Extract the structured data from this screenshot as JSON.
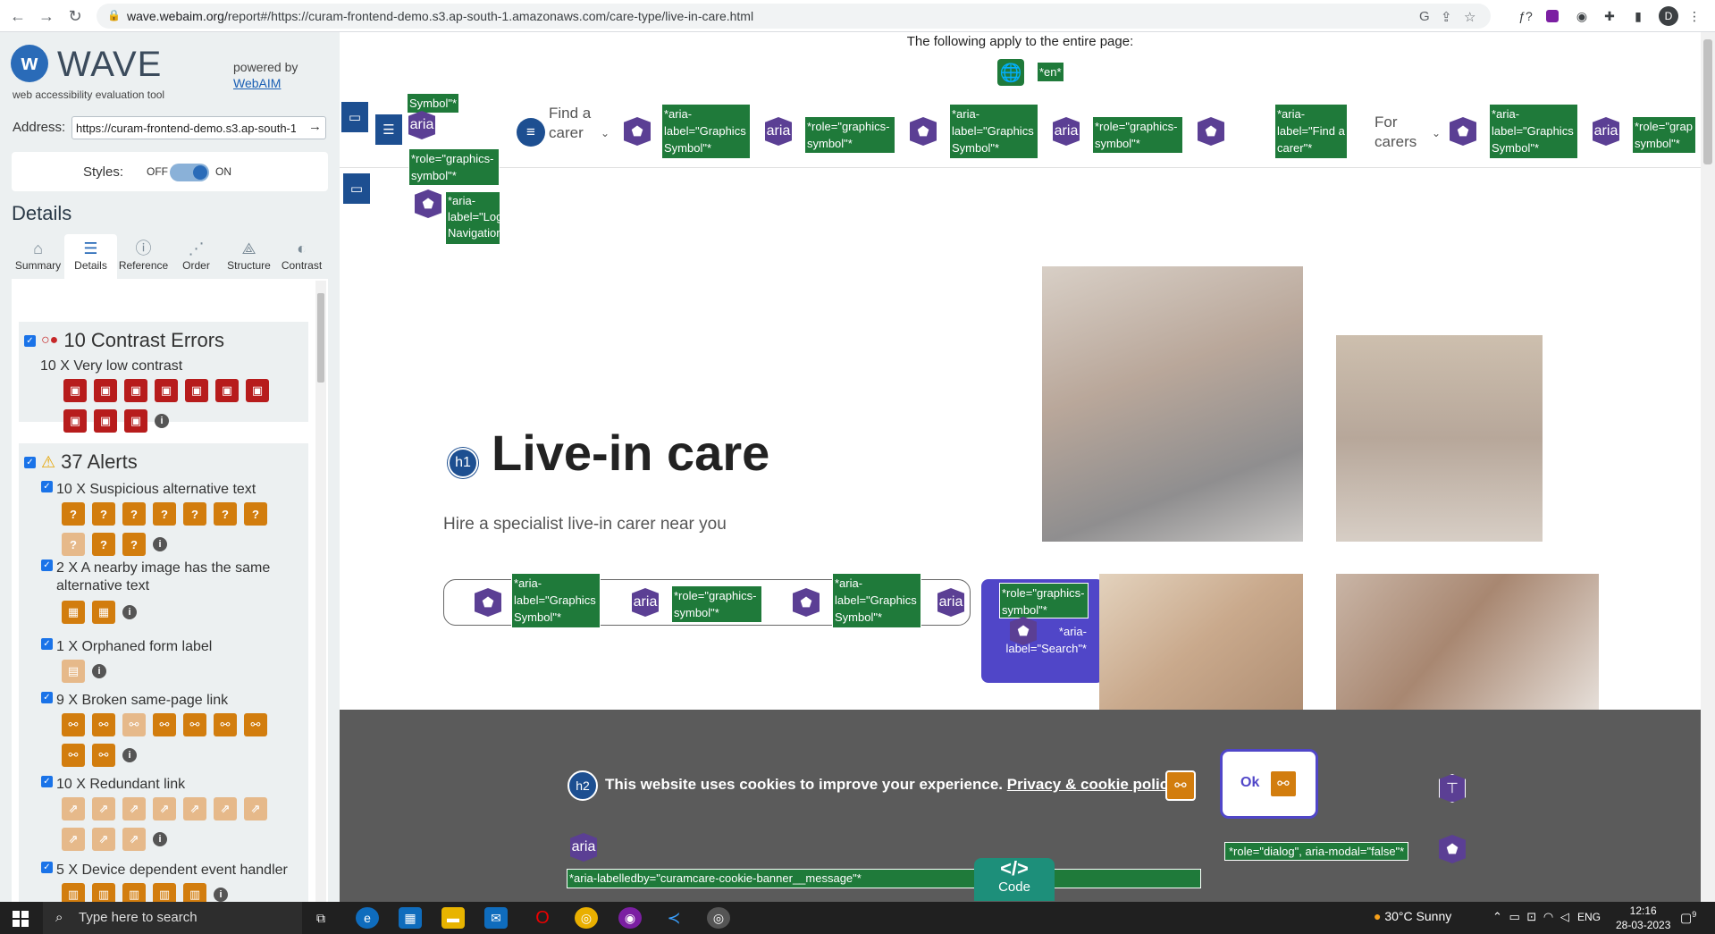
{
  "browser": {
    "url_prefix": "wave.webaim.org/",
    "url_rest": "report#/https://curam-frontend-demo.s3.ap-south-1.amazonaws.com/care-type/live-in-care.html",
    "avatar_letter": "D"
  },
  "wave": {
    "title": "WAVE",
    "subtitle": "web accessibility evaluation tool",
    "powered_by": "powered by",
    "powered_link": "WebAIM",
    "address_label": "Address:",
    "address_value": "https://curam-frontend-demo.s3.ap-south-1",
    "styles_label": "Styles:",
    "styles_off": "OFF",
    "styles_on": "ON",
    "details_heading": "Details",
    "tabs": [
      {
        "label": "Summary",
        "icon": "home-icon"
      },
      {
        "label": "Details",
        "icon": "list-icon"
      },
      {
        "label": "Reference",
        "icon": "info-icon"
      },
      {
        "label": "Order",
        "icon": "order-icon"
      },
      {
        "label": "Structure",
        "icon": "structure-icon"
      },
      {
        "label": "Contrast",
        "icon": "contrast-icon"
      }
    ],
    "contrast": {
      "heading": "10 Contrast Errors",
      "item": "10 X Very low contrast",
      "count": 10
    },
    "alerts": {
      "heading": "37 Alerts",
      "items": [
        {
          "label": "10 X Suspicious alternative text",
          "count": 10
        },
        {
          "label": "2 X A nearby image has the same alternative text",
          "count": 2
        },
        {
          "label": "1 X Orphaned form label",
          "count": 1
        },
        {
          "label": "9 X Broken same-page link",
          "count": 9
        },
        {
          "label": "10 X Redundant link",
          "count": 10
        },
        {
          "label": "5 X Device dependent event handler",
          "count": 5
        }
      ]
    }
  },
  "page": {
    "apply_text": "The following apply to the entire page:",
    "lang_tag": "*en*",
    "nav_tags": {
      "symbol": "Symbol\"*",
      "role_graphics_symbol": "*role=\"graphics-symbol\"*",
      "aria_label_graphics_symbol": "*aria-label=\"Graphics Symbol\"*",
      "aria_label_find_carer": "*aria-label=\"Find a carer\"*",
      "aria_label_logo": "*aria-label=\"Logo Navigation\"*",
      "role_graphics_symbol_short": "*role=\"grap symbol\"*"
    },
    "nav_find_carer": "Find a carer",
    "nav_for_carers": "For carers",
    "aria_badge": "aria",
    "h1_badge": "h1",
    "h1": "Live-in care",
    "subtitle": "Hire a specialist live-in carer near you",
    "search_tags": {
      "aria_label_graphics_symbol": "*aria-label=\"Graphics Symbol\"*",
      "role_graphics_symbol": "*role=\"graphics-symbol\"*",
      "aria_label_search": "*aria-label=\"Search\"*"
    },
    "cookie": {
      "h2_badge": "h2",
      "message": "This website uses cookies to improve your experience.",
      "link": "Privacy & cookie policy",
      "ok": "Ok",
      "role_dialog": "*role=\"dialog\", aria-modal=\"false\"*",
      "labelledby": "*aria-labelledby=\"curamcare-cookie-banner__message\"*"
    },
    "code_label": "Code"
  },
  "taskbar": {
    "search_placeholder": "Type here to search",
    "weather": "30°C  Sunny",
    "lang": "ENG",
    "time": "12:16",
    "date": "28-03-2023",
    "notifications": "9"
  }
}
